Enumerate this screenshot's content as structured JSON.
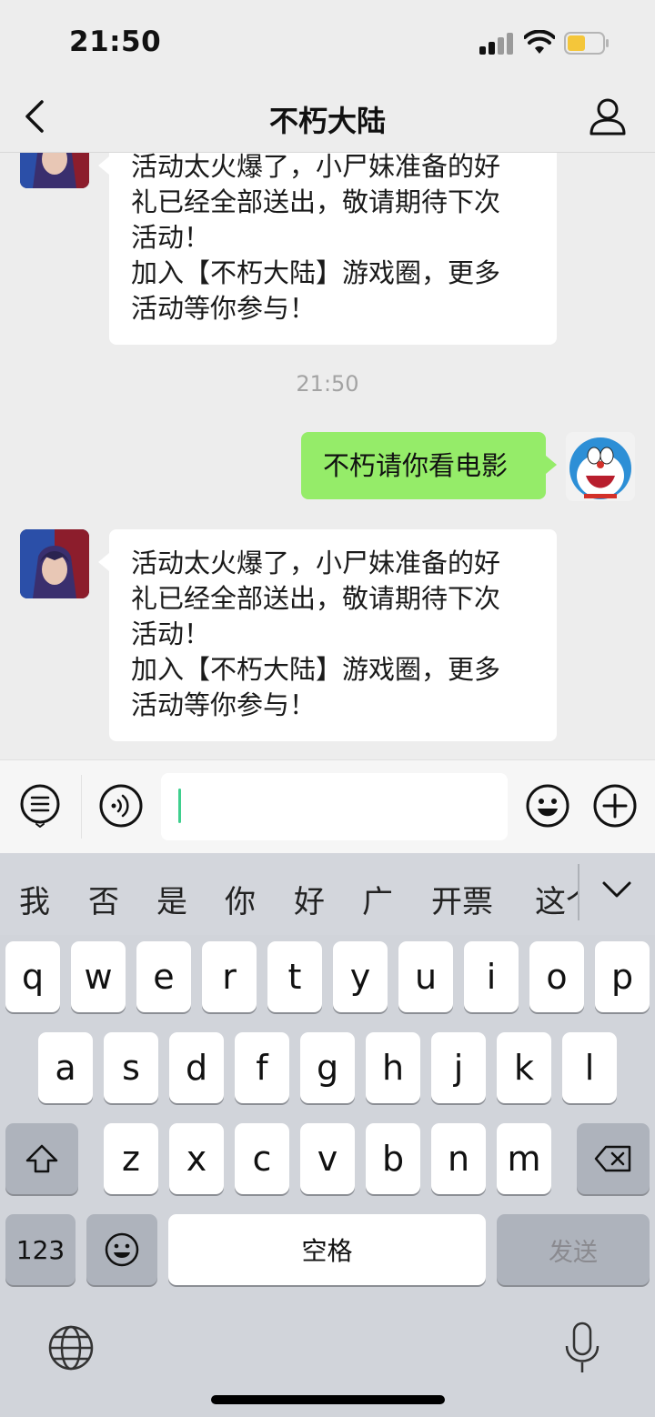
{
  "status_bar": {
    "time": "21:50"
  },
  "nav": {
    "title": "不朽大陆"
  },
  "chat": {
    "messages": [
      {
        "side": "in",
        "lines": [
          "活动太火爆了，小尸妹准备的好",
          "礼已经全部送出，敬请期待下次",
          "活动！",
          "加入【不朽大陆】游戏圈，更多",
          "活动等你参与！"
        ]
      },
      {
        "type": "timestamp",
        "text": "21:50"
      },
      {
        "side": "out",
        "text": "不朽请你看电影"
      },
      {
        "side": "in",
        "lines": [
          "活动太火爆了，小尸妹准备的好",
          "礼已经全部送出，敬请期待下次",
          "活动！",
          "加入【不朽大陆】游戏圈，更多",
          "活动等你参与！"
        ]
      }
    ]
  },
  "input": {
    "value": ""
  },
  "keyboard": {
    "candidates": [
      "我",
      "否",
      "是",
      "你",
      "好",
      "广",
      "开票",
      "这个"
    ],
    "row1": [
      "q",
      "w",
      "e",
      "r",
      "t",
      "y",
      "u",
      "i",
      "o",
      "p"
    ],
    "row2": [
      "a",
      "s",
      "d",
      "f",
      "g",
      "h",
      "j",
      "k",
      "l"
    ],
    "row3": [
      "z",
      "x",
      "c",
      "v",
      "b",
      "n",
      "m"
    ],
    "numbers_label": "123",
    "space_label": "空格",
    "send_label": "发送"
  },
  "colors": {
    "outgoing_bubble": "#95ec69",
    "incoming_bubble": "#ffffff",
    "caret": "#3fcf8e"
  },
  "icons": [
    "back-icon",
    "profile-icon",
    "list-icon",
    "voice-icon",
    "emoji-icon",
    "plus-icon",
    "shift-icon",
    "delete-icon",
    "globe-icon",
    "mic-icon"
  ]
}
